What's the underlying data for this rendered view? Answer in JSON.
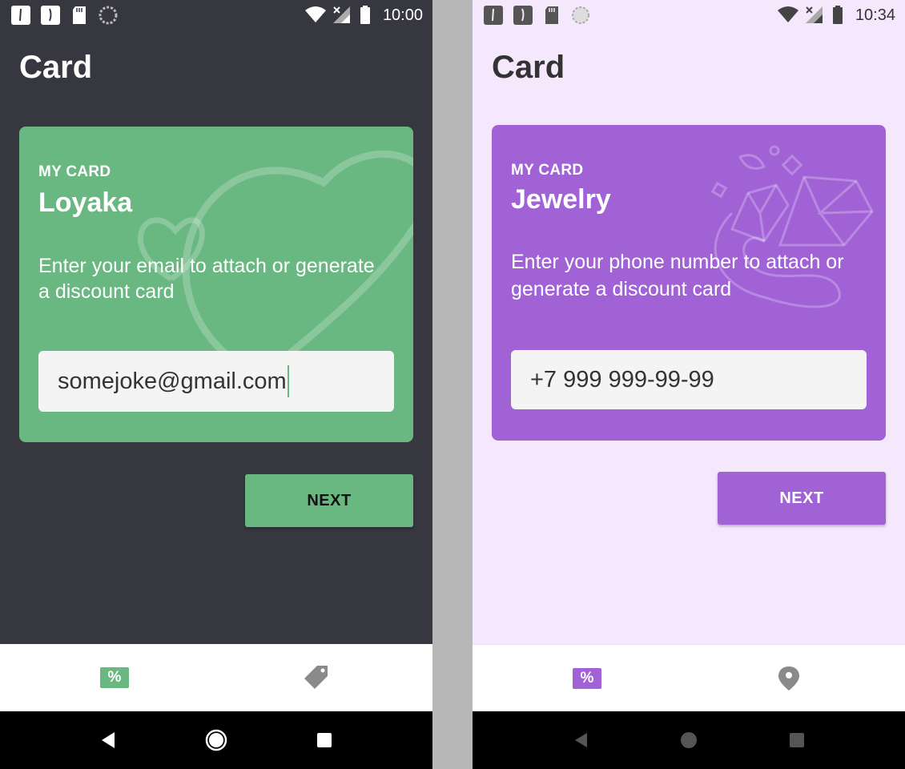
{
  "left": {
    "status": {
      "time": "10:00"
    },
    "title": "Card",
    "card": {
      "kicker": "MY CARD",
      "name": "Loyaka",
      "description": "Enter your email to attach or generate a discount card",
      "input_value": "somejoke@gmail.com",
      "decoration": "heart-pattern"
    },
    "next_label": "NEXT",
    "bottom_nav": [
      {
        "icon": "percent-icon",
        "label": "%"
      },
      {
        "icon": "tag-icon"
      }
    ],
    "colors": {
      "accent": "#69b882",
      "background": "#373740"
    }
  },
  "right": {
    "status": {
      "time": "10:34"
    },
    "title": "Card",
    "card": {
      "kicker": "MY CARD",
      "name": "Jewelry",
      "description": "Enter your phone number to attach or generate a discount card",
      "input_value": "+7 999 999-99-99",
      "decoration": "jewelry-pattern"
    },
    "next_label": "NEXT",
    "bottom_nav": [
      {
        "icon": "percent-icon",
        "label": "%"
      },
      {
        "icon": "map-pin-icon"
      }
    ],
    "colors": {
      "accent": "#a162d6",
      "background": "#f5e8fd"
    }
  }
}
